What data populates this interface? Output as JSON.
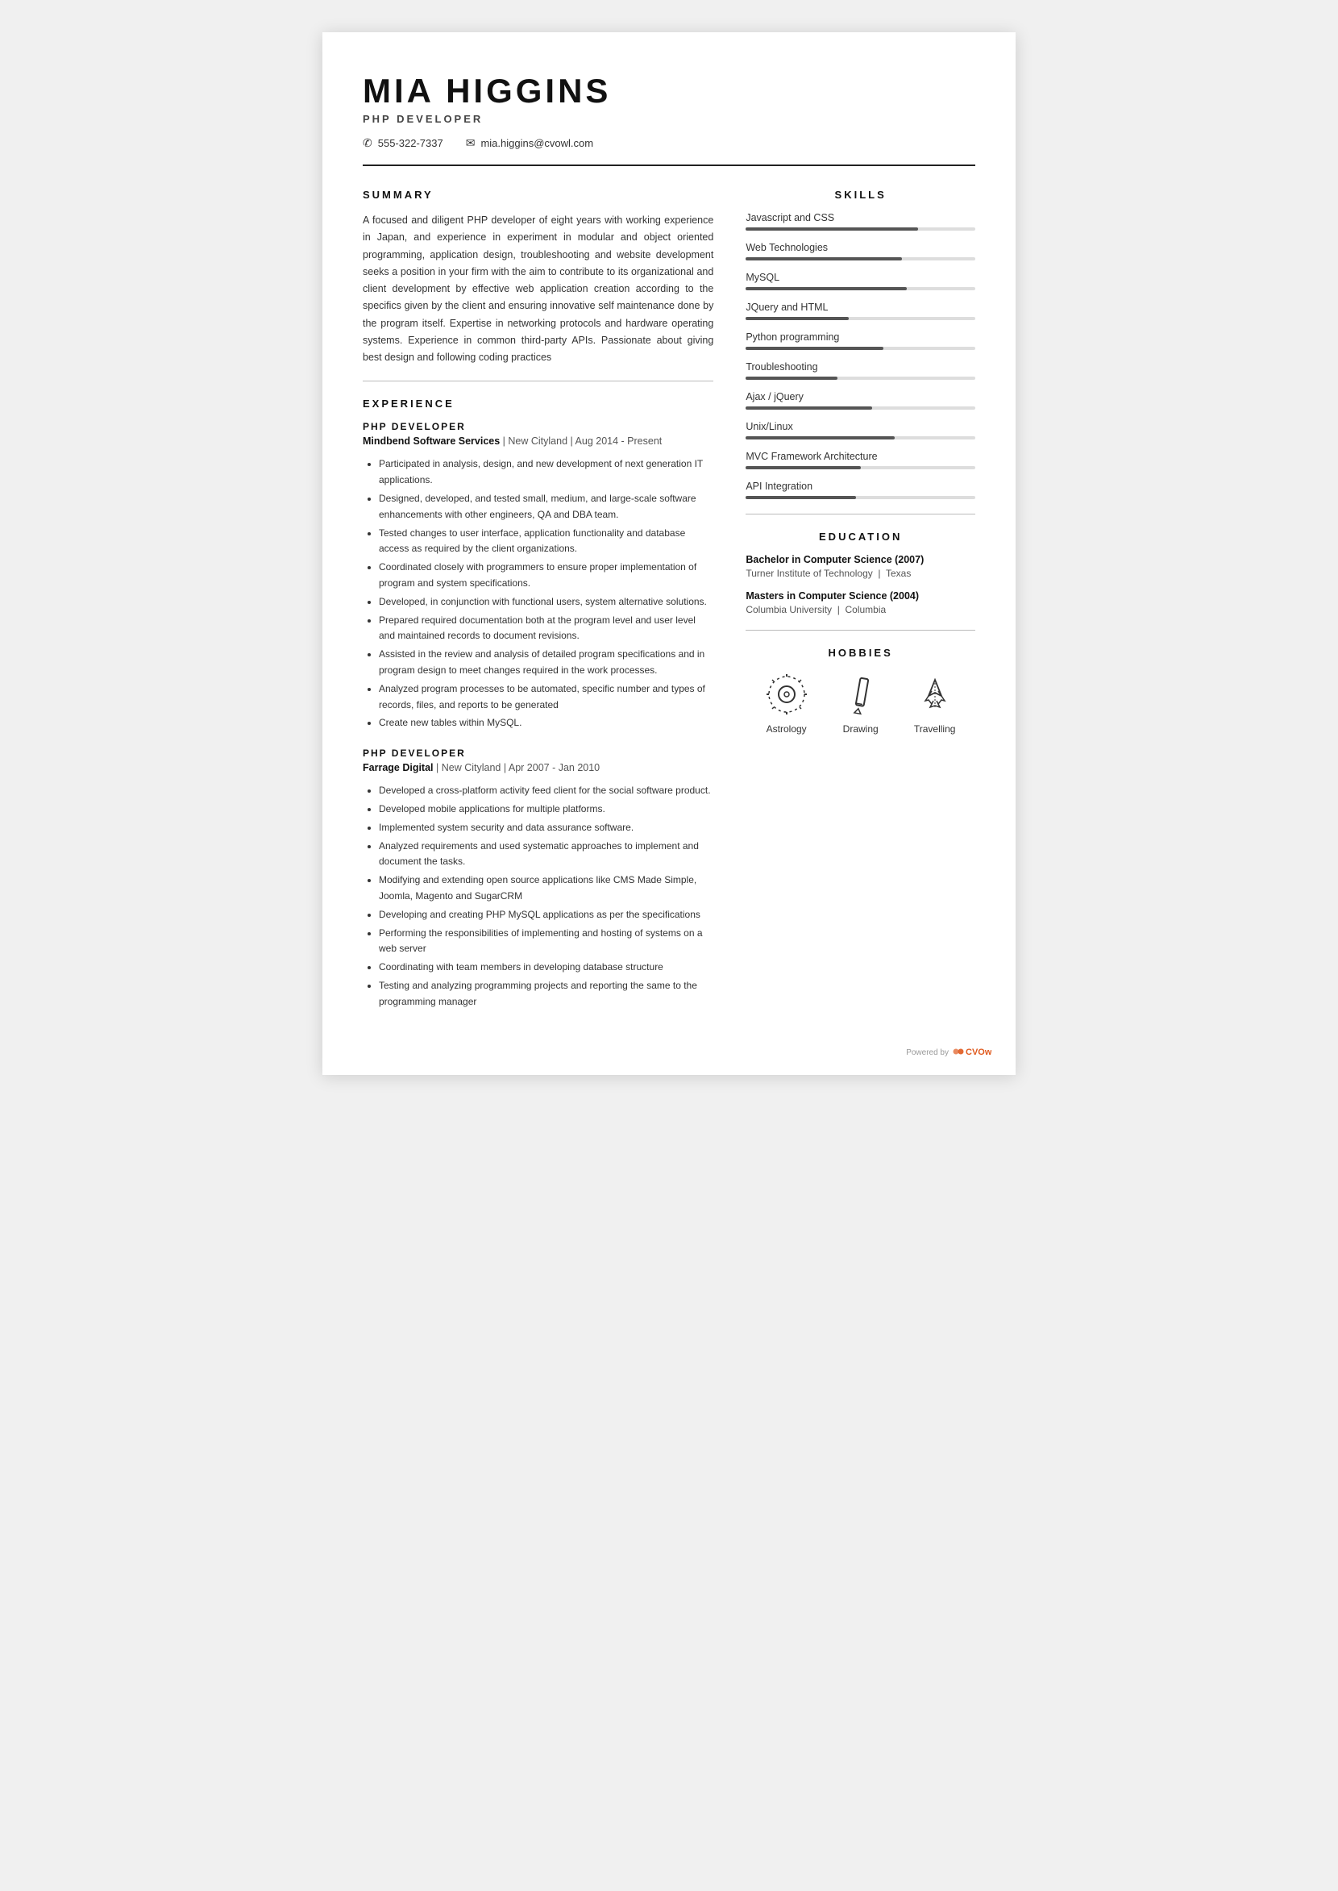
{
  "header": {
    "name": "MIA HIGGINS",
    "job_title": "PHP DEVELOPER",
    "phone": "555-322-7337",
    "email": "mia.higgins@cvowl.com"
  },
  "summary": {
    "title": "SUMMARY",
    "text": "A focused and diligent PHP developer of eight years with working experience in Japan, and experience in experiment in modular and object oriented programming, application design, troubleshooting and website development seeks a position in your firm with the aim to contribute to its organizational and client development by effective web application creation according to the specifics given by the client and ensuring innovative self maintenance done by the program itself. Expertise in networking protocols and hardware operating systems. Experience in common third-party APIs. Passionate about giving best design and following coding practices"
  },
  "experience": {
    "title": "EXPERIENCE",
    "jobs": [
      {
        "role": "PHP DEVELOPER",
        "company": "Mindbend Software Services",
        "location": "New Cityland",
        "period": "Aug 2014 - Present",
        "bullets": [
          "Participated in analysis, design, and new development of next generation IT applications.",
          "Designed, developed, and tested small, medium, and large-scale software enhancements with other engineers, QA and DBA team.",
          "Tested changes to user interface, application functionality and database access as required by the client organizations.",
          "Coordinated closely with programmers to ensure proper implementation of program and system specifications.",
          "Developed, in conjunction with functional users, system alternative solutions.",
          "Prepared required documentation both at the program level and user level and maintained records to document revisions.",
          "Assisted in the review and analysis of detailed program specifications and in program design to meet changes required in the work processes.",
          "Analyzed program processes to be automated, specific number and types of records, files, and reports to be generated",
          "Create new tables within MySQL."
        ]
      },
      {
        "role": "PHP DEVELOPER",
        "company": "Farrage Digital",
        "location": "New Cityland",
        "period": "Apr 2007 - Jan 2010",
        "bullets": [
          "Developed a cross-platform activity feed client for the social software product.",
          "Developed mobile applications for multiple platforms.",
          "Implemented system security and data assurance software.",
          "Analyzed requirements and used systematic approaches to implement and document the tasks.",
          "Modifying and extending open source applications like CMS Made Simple, Joomla, Magento and SugarCRM",
          "Developing and creating PHP MySQL applications as per the specifications",
          "Performing the responsibilities of implementing and hosting of systems on a web server",
          "Coordinating with team members in developing database structure",
          "Testing and analyzing programming projects and reporting the same to the programming manager"
        ]
      }
    ]
  },
  "skills": {
    "title": "SKILLS",
    "items": [
      {
        "name": "Javascript and CSS",
        "pct": 75
      },
      {
        "name": "Web Technologies",
        "pct": 68
      },
      {
        "name": "MySQL",
        "pct": 70
      },
      {
        "name": "JQuery and HTML",
        "pct": 45
      },
      {
        "name": "Python programming",
        "pct": 60
      },
      {
        "name": "Troubleshooting",
        "pct": 40
      },
      {
        "name": "Ajax / jQuery",
        "pct": 55
      },
      {
        "name": "Unix/Linux",
        "pct": 65
      },
      {
        "name": "MVC Framework Architecture",
        "pct": 50
      },
      {
        "name": "API Integration",
        "pct": 48
      }
    ]
  },
  "education": {
    "title": "EDUCATION",
    "items": [
      {
        "degree": "Bachelor in Computer Science (2007)",
        "institution": "Turner Institute of Technology",
        "location": "Texas"
      },
      {
        "degree": "Masters in Computer Science (2004)",
        "institution": "Columbia University",
        "location": "Columbia"
      }
    ]
  },
  "hobbies": {
    "title": "HOBBIES",
    "items": [
      {
        "label": "Astrology",
        "icon": "astrology"
      },
      {
        "label": "Drawing",
        "icon": "drawing"
      },
      {
        "label": "Travelling",
        "icon": "travelling"
      }
    ]
  },
  "footer": {
    "powered_by": "Powered by",
    "brand": "CVOwl"
  }
}
